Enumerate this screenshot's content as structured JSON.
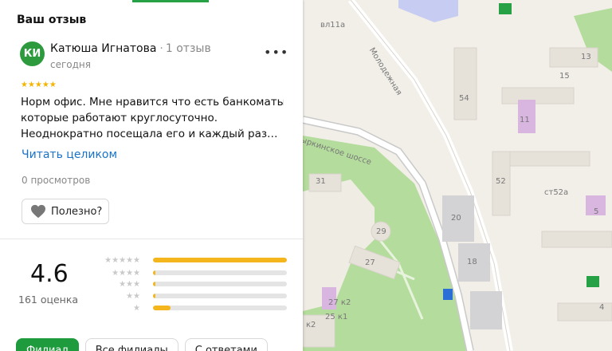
{
  "review_section": {
    "title": "Ваш отзыв"
  },
  "review": {
    "avatar_initials": "КИ",
    "author_name": "Катюша Игнатова",
    "separator": "·",
    "author_reviews": "1 отзыв",
    "date": "сегодня",
    "stars": "★★★★★",
    "rating": 5,
    "text_lines": [
      "Норм офис. Мне нравится что есть банкоматы",
      "которые работают круглосуточно.",
      "Неоднократно посещала его и каждый раз…"
    ],
    "read_more": "Читать целиком",
    "views": "0 просмотров",
    "helpful_label": "Полезно?",
    "more_label": "•••"
  },
  "summary": {
    "rating": "4.6",
    "count_label": "161 оценка",
    "distribution": [
      {
        "stars": 5,
        "glyphs": "★★★★★",
        "fraction": 1.0
      },
      {
        "stars": 4,
        "glyphs": "★★★★",
        "fraction": 0.02
      },
      {
        "stars": 3,
        "glyphs": "★★★",
        "fraction": 0.015
      },
      {
        "stars": 2,
        "glyphs": "★★",
        "fraction": 0.02
      },
      {
        "stars": 1,
        "glyphs": "★",
        "fraction": 0.13
      }
    ]
  },
  "filters": [
    {
      "label": "Филиал",
      "active": true
    },
    {
      "label": "Все филиалы",
      "active": false
    },
    {
      "label": "С ответами",
      "active": false
    }
  ],
  "map": {
    "street_labels": [
      "Молодежная",
      "Пыркинское шоссе"
    ],
    "building_labels": [
      "вл11а",
      "13",
      "15",
      "54",
      "11",
      "52",
      "ст52а",
      "5",
      "20",
      "18",
      "31",
      "29",
      "27",
      "27 к2",
      "25 к1",
      "к2",
      "4"
    ],
    "colors": {
      "background": "#f2efe9",
      "park": "#b4dc9c",
      "road": "#ffffff",
      "building": "#e6e2da",
      "accent_green": "#1e9b3c",
      "star_yellow": "#f5b51c"
    }
  }
}
